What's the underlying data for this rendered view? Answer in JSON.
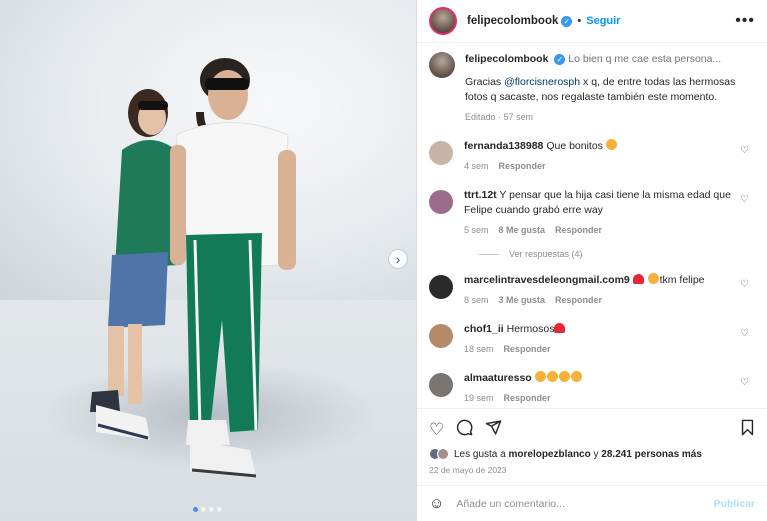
{
  "post": {
    "username": "felipecolombook",
    "follow_label": "Seguir",
    "separator": "•",
    "more_label": "•••"
  },
  "caption": {
    "username": "felipecolombook",
    "headline": "Lo bien q me cae esta persona...",
    "line1_pre": "Gracias ",
    "mention": "@florcisnerosph",
    "line1_post": " x q, de entre todas las hermosas fotos q sacaste, nos regalaste también este momento.",
    "edited": "Editado · 57 sem"
  },
  "comments": [
    {
      "user": "fernanda138988",
      "text": "Que bonitos",
      "time": "4 sem",
      "likes": "",
      "reply": "Responder",
      "avatar_color": "#c9b2a6"
    },
    {
      "user": "ttrt.12t",
      "text": "Y pensar que la hija casi tiene la misma edad que Felipe cuando grabó erre way",
      "time": "5 sem",
      "likes": "8 Me gusta",
      "reply": "Responder",
      "avatar_color": "#9b6d8a"
    },
    {
      "user": "marcelintravesdeleongmail.com9",
      "text": "tkm felipe",
      "time": "8 sem",
      "likes": "3 Me gusta",
      "reply": "Responder",
      "avatar_color": "#2b2b2b"
    },
    {
      "user": "chof1_ii",
      "text": "Hermosos",
      "time": "18 sem",
      "likes": "",
      "reply": "Responder",
      "avatar_color": "#b58a6a"
    },
    {
      "user": "almaaturesso",
      "text": "",
      "time": "19 sem",
      "likes": "",
      "reply": "Responder",
      "avatar_color": "#7a7570"
    }
  ],
  "replies_label": "Ver respuestas (4)",
  "likes": {
    "prefix": "Les gusta a ",
    "user": "morelopezblanco",
    "middle": " y ",
    "count": "28.241 personas más"
  },
  "date": "22 de mayo de 2023",
  "comment_box": {
    "placeholder": "Añade un comentario...",
    "post_label": "Publicar"
  },
  "colors": {
    "accent": "#0095f6",
    "verified": "#3897f0"
  }
}
